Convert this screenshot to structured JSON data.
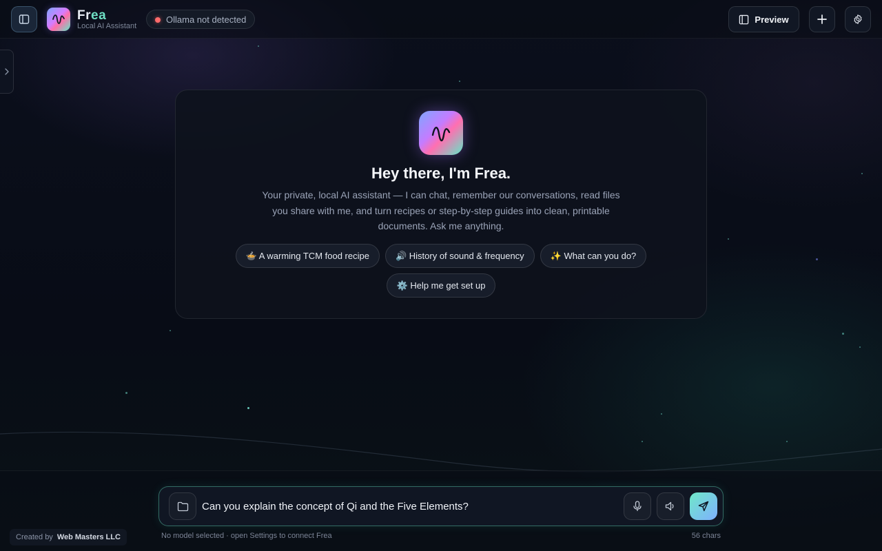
{
  "header": {
    "brand_prefix": "Fr",
    "brand_accent": "ea",
    "subtitle": "Local AI Assistant",
    "status": "Ollama not detected",
    "preview_label": "Preview"
  },
  "welcome": {
    "title": "Hey there, I'm Frea.",
    "description": "Your private, local AI assistant — I can chat, remember our conversations, read files you share with me, and turn recipes or step-by-step guides into clean, printable documents. Ask me anything.",
    "suggestions": [
      "🍲 A warming TCM food recipe",
      "🔊 History of sound & frequency",
      "✨ What can you do?",
      "⚙️ Help me get set up"
    ]
  },
  "composer": {
    "value": "Can you explain the concept of Qi and the Five Elements?",
    "hint": "No model selected · open Settings to connect Frea",
    "char_count": "56 chars"
  },
  "footer": {
    "credit_prefix": "Created by",
    "credit_name": "Web Masters LLC"
  },
  "icons": {
    "sidebar_toggle": "sidebar-icon",
    "preview": "panel-icon",
    "new_chat": "plus-icon",
    "settings": "gear-icon",
    "attach": "folder-icon",
    "mic": "mic-icon",
    "speaker": "speaker-icon",
    "send": "send-icon"
  },
  "colors": {
    "accent": "#6fe0c4",
    "status_error": "#ff6b6b",
    "background": "#080c16"
  }
}
